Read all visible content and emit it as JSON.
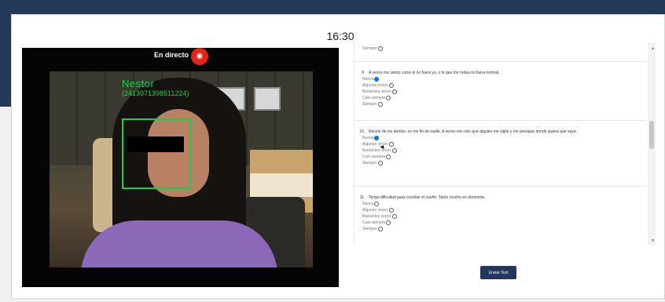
{
  "header": {
    "timer": "16:30"
  },
  "video": {
    "live_label": "En directo",
    "detection_name": "Nestor",
    "detection_code": "(2413971396511224)"
  },
  "questions": [
    {
      "number": "",
      "prompt": "",
      "options": [
        {
          "label": "Siempre",
          "checked": false
        }
      ]
    },
    {
      "number": "8",
      "prompt": "A veces me siento como si no fuera yo, o lo que me rodea no fuera normal.",
      "options": [
        {
          "label": "Nunca",
          "checked": true
        },
        {
          "label": "Algunas veces",
          "checked": false
        },
        {
          "label": "Bastantes veces",
          "checked": false
        },
        {
          "label": "Casi siempre",
          "checked": false
        },
        {
          "label": "Siempre",
          "checked": false
        }
      ]
    },
    {
      "number": "10",
      "prompt": "Recelo de los demás, no me fio de nadie. A veces me creo que alguien me vigila y me persigue donde quiera que vaya.",
      "options": [
        {
          "label": "Nunca",
          "checked": true
        },
        {
          "label": "Algunas veces",
          "checked": false
        },
        {
          "label": "Bastantes veces",
          "checked": false
        },
        {
          "label": "Casi siempre",
          "checked": false
        },
        {
          "label": "Siempre",
          "checked": false
        }
      ]
    },
    {
      "number": "11",
      "prompt": "Tengo dificultad para conciliar el sueño. Tardo mucho en dormirme.",
      "options": [
        {
          "label": "Nunca",
          "checked": false
        },
        {
          "label": "Algunas veces",
          "checked": false
        },
        {
          "label": "Bastantes veces",
          "checked": false
        },
        {
          "label": "Casi siempre",
          "checked": false
        },
        {
          "label": "Siempre",
          "checked": false
        }
      ]
    }
  ],
  "actions": {
    "submit_label": "Enviar Test"
  },
  "colors": {
    "accent": "#24365e",
    "detection": "#18d14a",
    "live": "#e52419",
    "radio_checked": "#0b6ee0"
  }
}
